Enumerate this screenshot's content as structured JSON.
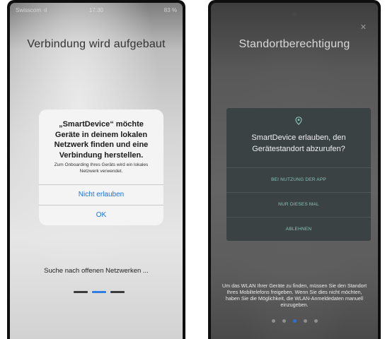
{
  "left_phone": {
    "status_bar": {
      "carrier": "Swisscom ᐧıl",
      "time": "17:30",
      "battery": "83 %"
    },
    "title": "Verbindung wird aufgebaut",
    "alert": {
      "title": "„SmartDevice“ möchte Geräte in deinem lokalen Netzwerk finden und eine Verbindung herstellen.",
      "message": "Zum Onboarding Ihres Geräts wird ein lokales Netzwerk verwendet.",
      "buttons": [
        "Nicht erlauben",
        "OK"
      ]
    },
    "scan_text": "Suche nach offenen Netzwerken ...",
    "progress": {
      "steps": 3,
      "active_step": 2
    }
  },
  "right_phone": {
    "close_icon": "close-icon",
    "title": "Standortberechtigung",
    "dialog": {
      "icon": "location-pin-icon",
      "title": "SmartDevice erlauben, den Gerätestandort abzurufen?",
      "buttons": [
        "BEI NUTZUNG DER APP",
        "NUR DIESES MAL",
        "ABLEHNEN"
      ]
    },
    "info_text": "Um das WLAN Ihrer Geräte zu finden, müssen Sie den Standort Ihres Mobiltelefons freigeben. Wenn Sie dies nicht möchten, haben Sie die Möglichkeit, die WLAN-Anmeldedaten manuell einzugeben.",
    "pager": {
      "pages": 5,
      "active_page": 3
    }
  },
  "colors": {
    "ios_link": "#1a73e8",
    "android_accent": "#87c4bb",
    "active_indicator": "#2f7fe0"
  }
}
